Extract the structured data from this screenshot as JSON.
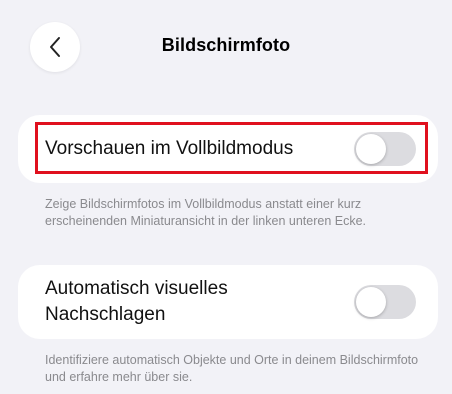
{
  "header": {
    "title": "Bildschirmfoto",
    "back_icon": "chevron-left-icon"
  },
  "settings": [
    {
      "label": "Vorschauen im Vollbildmodus",
      "toggle_on": false,
      "description": "Zeige Bildschirmfotos im Vollbildmodus anstatt einer kurz erscheinenden Miniaturansicht in der linken unteren Ecke."
    },
    {
      "label": "Automatisch visuelles Nachschlagen",
      "toggle_on": false,
      "description": "Identifiziere automatisch Objekte und Orte in deinem Bildschirmfoto und erfahre mehr über sie."
    }
  ],
  "colors": {
    "background": "#f2f2f7",
    "card": "#ffffff",
    "toggle_off": "#dcdce0",
    "highlight": "#e0101e",
    "footnote": "#8a8a8e"
  }
}
